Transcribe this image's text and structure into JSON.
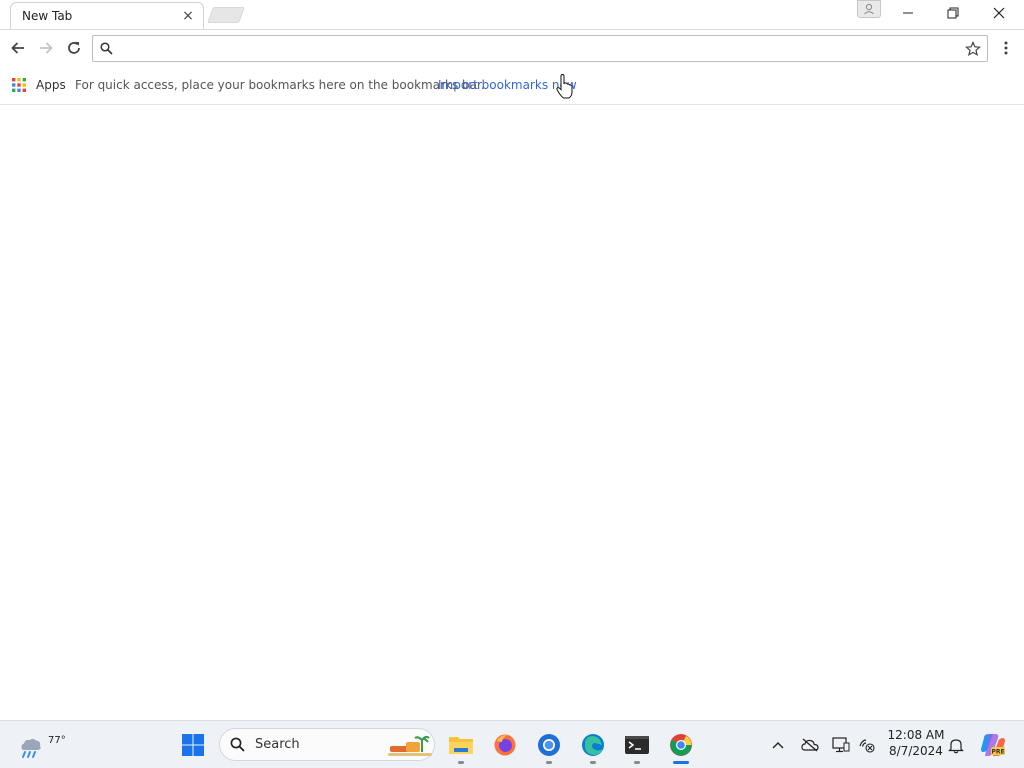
{
  "tab": {
    "title": "New Tab",
    "close_symbol": "×"
  },
  "omnibox": {
    "value": "",
    "placeholder": ""
  },
  "bookmarks_bar": {
    "apps_label": "Apps",
    "hint_text": "For quick access, place your bookmarks here on the bookmarks bar.",
    "import_link": "Import bookmarks now"
  },
  "taskbar": {
    "weather_temp": "77°",
    "search_label": "Search",
    "clock_time": "12:08 AM",
    "clock_date": "8/7/2024"
  },
  "colors": {
    "link": "#3367d6",
    "taskbar_bg": "#eef1f6",
    "accent": "#1a73e8"
  },
  "icons": [
    "back-icon",
    "forward-icon",
    "reload-icon",
    "search-icon",
    "star-icon",
    "menu-icon",
    "apps-icon",
    "windows-start-icon",
    "file-explorer-icon",
    "firefox-icon",
    "chromium-icon",
    "edge-icon",
    "terminal-icon",
    "chrome-icon",
    "chevron-up-icon",
    "cloud-offline-icon",
    "display-icon",
    "network-icon",
    "bell-icon",
    "copilot-icon"
  ]
}
